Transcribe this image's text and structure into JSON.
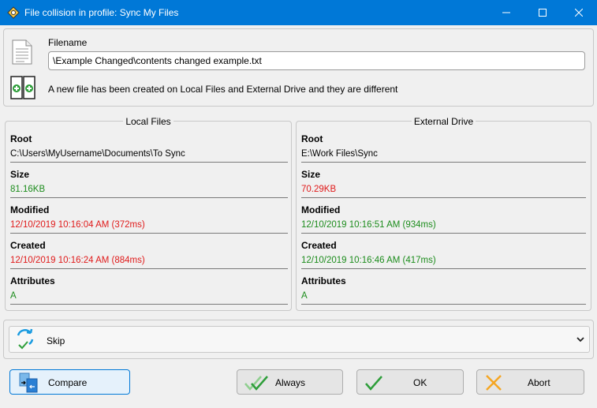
{
  "window": {
    "title": "File collision in profile: Sync My Files",
    "app_icon": "gear-diamond-icon"
  },
  "file": {
    "filename_label": "Filename",
    "filename_value": "\\Example Changed\\contents changed example.txt",
    "message": "A new file has been created on Local Files and External Drive and they are different"
  },
  "local": {
    "title": "Local Files",
    "root_label": "Root",
    "root_value": "C:\\Users\\MyUsername\\Documents\\To Sync",
    "size_label": "Size",
    "size_value": "81.16KB",
    "modified_label": "Modified",
    "modified_value": "12/10/2019 10:16:04 AM (372ms)",
    "created_label": "Created",
    "created_value": "12/10/2019 10:16:24 AM (884ms)",
    "attributes_label": "Attributes",
    "attributes_value": "A"
  },
  "external": {
    "title": "External Drive",
    "root_label": "Root",
    "root_value": "E:\\Work Files\\Sync",
    "size_label": "Size",
    "size_value": "70.29KB",
    "modified_label": "Modified",
    "modified_value": "12/10/2019 10:16:51 AM (934ms)",
    "created_label": "Created",
    "created_value": "12/10/2019 10:16:46 AM (417ms)",
    "attributes_label": "Attributes",
    "attributes_value": "A"
  },
  "action": {
    "selected": "Skip"
  },
  "buttons": {
    "compare": "Compare",
    "always": "Always",
    "ok": "OK",
    "abort": "Abort"
  },
  "colors": {
    "titlebar": "#0078d7",
    "newer": "#1c8c1c",
    "older": "#e01a1a"
  }
}
